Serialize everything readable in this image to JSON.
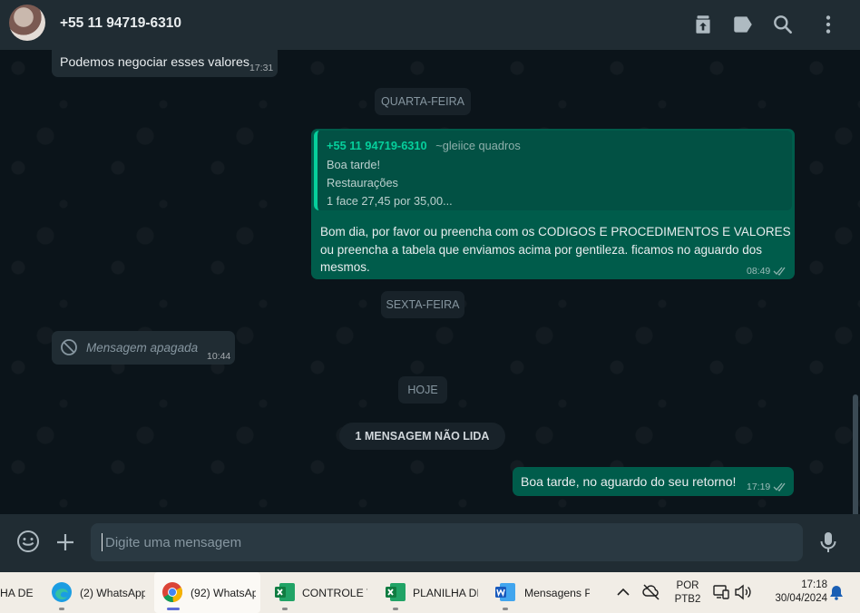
{
  "header": {
    "contact_name": "+55 11 94719-6310",
    "icons": [
      "archive-icon",
      "label-icon",
      "search-icon",
      "menu-icon"
    ]
  },
  "chat": {
    "msg1": {
      "text": "Podemos negociar esses valores",
      "time": "17:31"
    },
    "date1": "QUARTA-FEIRA",
    "reply": {
      "quoted_sender": "+55 11 94719-6310",
      "quoted_pushname": "~gleiice quadros",
      "quoted_lines": [
        "Boa tarde!",
        "Restaurações",
        "1 face 27,45 por 35,00..."
      ],
      "text_lines": [
        "Bom dia, por favor ou preencha com os CODIGOS E PROCEDIMENTOS E VALORES",
        "ou preencha a tabela que enviamos acima por gentileza. ficamos no aguardo dos",
        "mesmos."
      ],
      "time": "08:49"
    },
    "date2": "SEXTA-FEIRA",
    "deleted": {
      "text": "Mensagem apagada",
      "time": "10:44"
    },
    "date3": "HOJE",
    "unread": "1 MENSAGEM NÃO LIDA",
    "last": {
      "text": "Boa tarde, no aguardo do seu retorno!",
      "time": "17:19"
    }
  },
  "composer": {
    "placeholder": "Digite uma mensagem"
  },
  "taskbar": {
    "items": [
      "HA DE",
      "(2) WhatsApp",
      "(92) WhatsAp",
      "CONTROLE T",
      "PLANILHA DE",
      "Mensagens P"
    ],
    "lang_top": "POR",
    "lang_bottom": "PTB2",
    "time": "17:18",
    "date": "30/04/2024"
  },
  "colors": {
    "header_bg": "#202c33",
    "chat_bg": "#0b141a",
    "outgoing_bubble": "#005c4b",
    "incoming_bubble": "#202c33",
    "accent": "#06cf9c"
  }
}
